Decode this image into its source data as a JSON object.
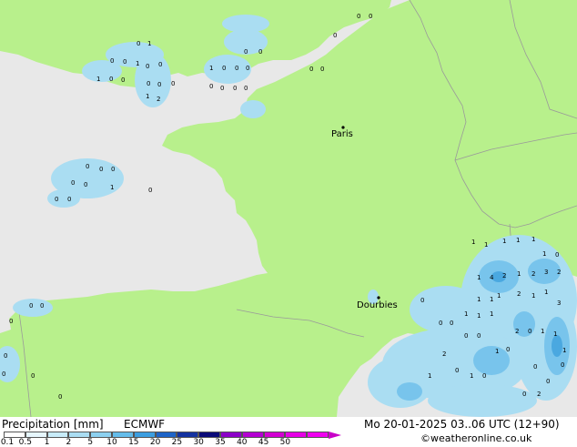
{
  "colors": {
    "sea": "#e8e8e8",
    "land": "#b8f08c",
    "border": "#9a9a9a",
    "precip_light": "#aaddf2",
    "precip_mid": "#78c4ec",
    "precip_strong": "#4aa8e0"
  },
  "cities": [
    {
      "name": "Paris"
    },
    {
      "name": "Dourbies"
    }
  ],
  "precip_labels": [
    "0",
    "1",
    "0",
    "0",
    "1",
    "0",
    "0",
    "1",
    "0",
    "0",
    "0",
    "0",
    "0",
    "1",
    "2",
    "1",
    "0",
    "0",
    "0",
    "0",
    "0",
    "0",
    "0",
    "0",
    "0",
    "0",
    "0",
    "0",
    "0",
    "0",
    "0",
    "0",
    "0",
    "0",
    "0",
    "1",
    "0",
    "0",
    "0",
    "0",
    "0",
    "0",
    "0",
    "0",
    "0",
    "0",
    "0",
    "1",
    "1",
    "1",
    "1",
    "1",
    "1",
    "0",
    "1",
    "4",
    "2",
    "1",
    "2",
    "3",
    "2",
    "1",
    "2",
    "1",
    "1",
    "3",
    "1",
    "1",
    "1",
    "1",
    "1",
    "0",
    "0",
    "0",
    "0",
    "1",
    "0",
    "2",
    "0",
    "1",
    "1",
    "1",
    "0",
    "0",
    "2",
    "0",
    "0",
    "0",
    "1",
    "0",
    "2",
    "1",
    "1",
    "3",
    "0",
    "0",
    "0"
  ],
  "legend": {
    "title": "Precipitation [mm]",
    "model": "ECMWF",
    "datetime": "Mo 20-01-2025 03..06 UTC (12+90)",
    "credit": "©weatheronline.co.uk",
    "ticks": [
      "0.1",
      "0.5",
      "1",
      "2",
      "5",
      "10",
      "15",
      "20",
      "25",
      "30",
      "35",
      "40",
      "45",
      "50"
    ],
    "colors": [
      "#ffffff",
      "#e6f6fd",
      "#c8ecfa",
      "#aaddf2",
      "#8cd0f0",
      "#64bcea",
      "#3c9ee0",
      "#1e64c8",
      "#1432a0",
      "#0a0a78",
      "#8c00c8",
      "#b400d2",
      "#d200d2",
      "#e600e6",
      "#f000f0"
    ]
  }
}
